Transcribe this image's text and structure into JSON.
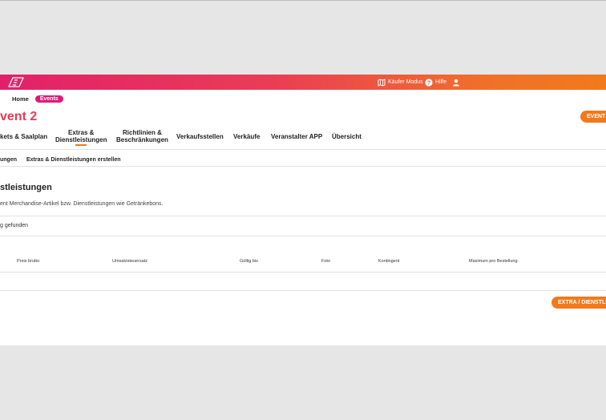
{
  "header": {
    "buyer_mode_label": "Käufer Modus",
    "help_label": "Hilfe",
    "colors": {
      "gradient_start": "#e2206a",
      "gradient_end": "#f17a1c"
    }
  },
  "breadcrumb": {
    "home": "Home",
    "events": "Events"
  },
  "event": {
    "title": "vent 2",
    "button_label": "EVENT"
  },
  "tabs": [
    {
      "line1": "kets & Saalplan",
      "line2": ""
    },
    {
      "line1": "Extras &",
      "line2": "Dienstleistungen",
      "active": true
    },
    {
      "line1": "Richtlinien &",
      "line2": "Beschränkungen"
    },
    {
      "line1": "Verkaufsstellen",
      "line2": ""
    },
    {
      "line1": "Verkäufe",
      "line2": ""
    },
    {
      "line1": "Veranstalter APP",
      "line2": ""
    },
    {
      "line1": "Übersicht",
      "line2": ""
    }
  ],
  "subtabs": [
    "ungen",
    "Extras & Dienstleistungen erstellen"
  ],
  "section": {
    "title": "stleistungen",
    "description": "ent Merchandise-Artikel bzw. Dienstleistungen wie Getränkebons.",
    "empty_message": "g gefunden"
  },
  "table": {
    "headers": [
      "Preis brutto",
      "Umsatzsteuersatz",
      "Gültig bis",
      "Foto",
      "Kontingent",
      "Maximum pro Bestellung"
    ]
  },
  "add_button_label": "EXTRA / DIENSTLE",
  "icons": [
    "logo-icon",
    "map-swap-icon",
    "help-circle-icon",
    "user-icon"
  ]
}
